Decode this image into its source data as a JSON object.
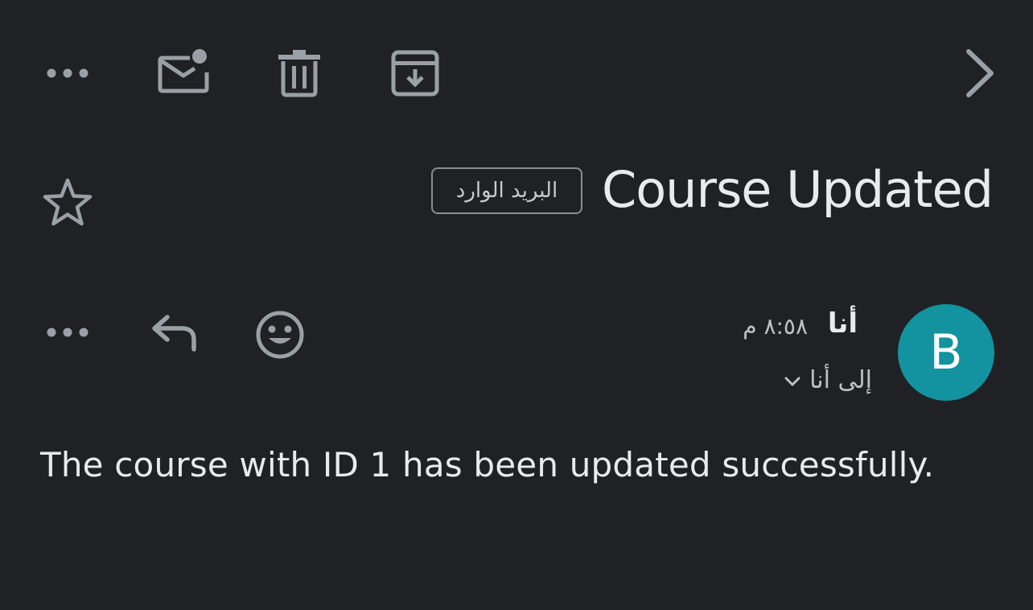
{
  "toolbar": {
    "icons": [
      "more-options-icon",
      "mark-unread-icon",
      "delete-icon",
      "archive-icon",
      "next-chevron-icon"
    ]
  },
  "email": {
    "subject": "Course Updated",
    "label": "البريد الوارد",
    "starred": false
  },
  "message": {
    "avatar_letter": "B",
    "avatar_color": "#12939f",
    "sender": "أنا",
    "time": "٨:٥٨ م",
    "recipient": "إلى أنا",
    "body": "The course with ID 1 has been updated successfully."
  },
  "colors": {
    "background": "#202124",
    "icon": "#9aa0a6",
    "text": "#e8eaed"
  }
}
